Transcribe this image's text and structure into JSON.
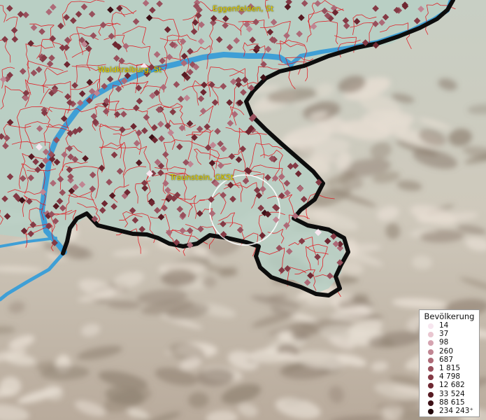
{
  "map": {
    "place_labels": [
      {
        "id": "eggenfelden",
        "text": "Eggenfelden, St"
      },
      {
        "id": "waldkraiburg",
        "text": "Waldkraiburg, St"
      },
      {
        "id": "traunstein",
        "text": "Traunstein, GKSt"
      }
    ],
    "colors": {
      "water": "#3f9fd6",
      "municipal_boundary": "#e3121b",
      "national_border": "#0d0d0d",
      "lowland": "#b7cdc2",
      "mountain_light": "#e6ddd2",
      "mountain_shadow": "#8a7b6c"
    }
  },
  "legend": {
    "title": "Bevölkerung",
    "items": [
      {
        "label": "14",
        "color": "#f7e6ef"
      },
      {
        "label": "37",
        "color": "#e9c6d0"
      },
      {
        "label": "98",
        "color": "#d5a3b0"
      },
      {
        "label": "260",
        "color": "#c08592"
      },
      {
        "label": "687",
        "color": "#ad6a77"
      },
      {
        "label": "1 815",
        "color": "#98505c"
      },
      {
        "label": "4 798",
        "color": "#843a45"
      },
      {
        "label": "12 682",
        "color": "#6e2731"
      },
      {
        "label": "33 524",
        "color": "#571a22"
      },
      {
        "label": "88 615",
        "color": "#3d1016"
      },
      {
        "label": "234 243⁺",
        "color": "#20070a"
      }
    ]
  }
}
